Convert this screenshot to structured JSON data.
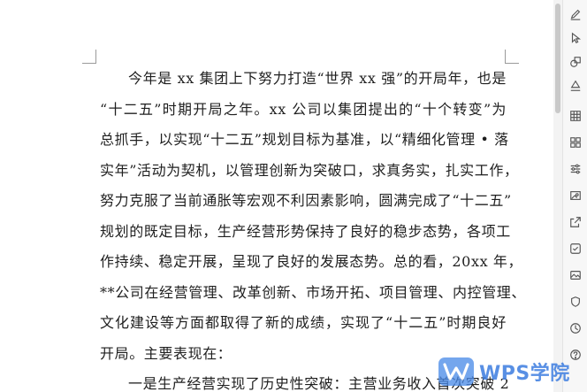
{
  "document": {
    "paragraph_1": [
      "今年是 xx 集团上下努力打造“世界 xx 强”的开局年，也是",
      "“十二五”时期开局之年。xx 公司以集团提出的“十个转变”为",
      "总抓手，以实现“十二五”规划目标为基准，以“精细化管理 • 落",
      "实年”活动为契机，以管理创新为突破口，求真务实，扎实工作，",
      "努力克服了当前通胀等宏观不利因素影响，圆满完成了“十二五”",
      "规划的既定目标，生产经营形势保持了良好的稳步态势，各项工",
      "作持续、稳定开展，呈现了良好的发展态势。总的看，20xx 年，",
      "**公司在经营管理、改革创新、市场开拓、项目管理、内控管理、",
      "文化建设等方面都取得了新的成绩，实现了“十二五”时期良好",
      "开局。主要表现在："
    ],
    "paragraph_2": [
      "一是生产经营实现了历史性突破：主营业务收入首次突破 2"
    ]
  },
  "toolbar": {
    "items": [
      {
        "name": "edit-pen-icon"
      },
      {
        "name": "select-pointer-icon"
      },
      {
        "name": "shapes-icon"
      },
      {
        "name": "fill-bucket-icon"
      },
      {
        "name": "table-icon"
      },
      {
        "name": "grid-apps-icon"
      },
      {
        "name": "adjust-sliders-icon"
      },
      {
        "name": "picture-in-frame-icon"
      },
      {
        "name": "share-export-icon"
      },
      {
        "name": "spellcheck-icon"
      },
      {
        "name": "image-icon"
      },
      {
        "name": "shield-icon"
      },
      {
        "name": "history-icon"
      },
      {
        "name": "help-icon"
      }
    ]
  },
  "watermark": {
    "text": "WPS学院"
  },
  "colors": {
    "text": "#1f1f1f",
    "accent": "#3b7ce0",
    "toolbar_bg": "#f7f7f7"
  }
}
